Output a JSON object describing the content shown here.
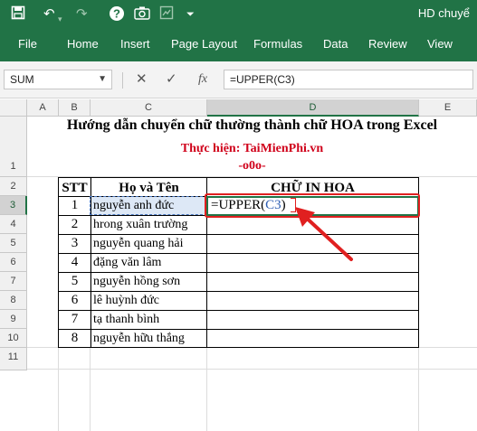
{
  "window": {
    "title": "HD chuyể"
  },
  "quick_access": {
    "save_icon": "save-icon",
    "undo_icon": "undo-icon",
    "redo_icon": "redo-icon",
    "help_icon": "help-icon",
    "screenshot_icon": "screenshot-icon",
    "customize_icon": "customize-icon"
  },
  "ribbon": {
    "tabs": [
      "File",
      "Home",
      "Insert",
      "Page Layout",
      "Formulas",
      "Data",
      "Review",
      "View"
    ]
  },
  "formula_bar": {
    "name_box": "SUM",
    "formula": "=UPPER(C3)",
    "cancel_icon": "close-icon",
    "enter_icon": "check-icon",
    "fx_label": "fx"
  },
  "columns": [
    "A",
    "B",
    "C",
    "D",
    "E"
  ],
  "rows": [
    "1",
    "2",
    "3",
    "4",
    "5",
    "6",
    "7",
    "8",
    "9",
    "10",
    "11"
  ],
  "sheet": {
    "title": "Hướng dẫn chuyển chữ thường thành chữ HOA trong Excel",
    "author": "Thực hiện: TaiMienPhi.vn",
    "separator": "-o0o-",
    "headers": {
      "stt": "STT",
      "name": "Họ và Tên",
      "upper": "CHỮ IN HOA"
    },
    "data_rows": [
      {
        "stt": "1",
        "name": "nguyễn anh đức"
      },
      {
        "stt": "2",
        "name": "hrong xuân trường"
      },
      {
        "stt": "3",
        "name": "nguyễn quang hải"
      },
      {
        "stt": "4",
        "name": "đặng văn lâm"
      },
      {
        "stt": "5",
        "name": "nguyễn hồng sơn"
      },
      {
        "stt": "6",
        "name": "lê huỳnh đức"
      },
      {
        "stt": "7",
        "name": "tạ thanh bình"
      },
      {
        "stt": "8",
        "name": "nguyễn hữu thắng"
      }
    ],
    "active_formula": {
      "prefix": "=UPPER(",
      "ref": "C3",
      "suffix": ")"
    }
  },
  "colors": {
    "excel_green": "#217346",
    "highlight_red": "#e02020",
    "reference_blue": "#2f5fb3",
    "title_red": "#d0021b"
  }
}
